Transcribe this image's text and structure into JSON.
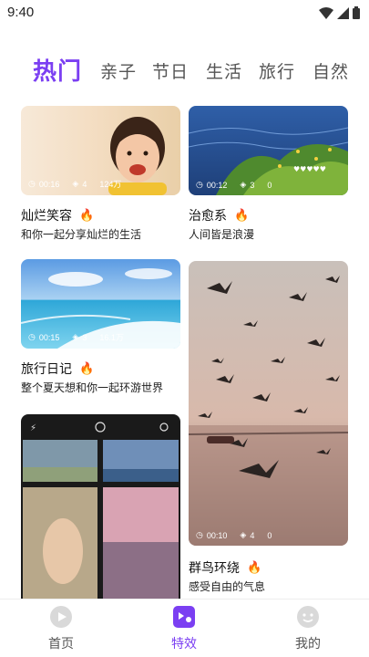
{
  "status": {
    "time": "9:40"
  },
  "tabs": [
    "热门",
    "亲子",
    "节日",
    "生活",
    "旅行",
    "自然"
  ],
  "cards": [
    {
      "title": "灿烂笑容",
      "subtitle": "和你一起分享灿烂的生活",
      "duration": "00:16",
      "layers": "4",
      "views": "124万"
    },
    {
      "title": "治愈系",
      "subtitle": "人间皆是浪漫",
      "duration": "00:12",
      "layers": "3",
      "views": "0"
    },
    {
      "title": "旅行日记",
      "subtitle": "整个夏天想和你一起环游世界",
      "duration": "00:15",
      "layers": "3",
      "views": "16.1万"
    },
    {
      "title": "群鸟环绕",
      "subtitle": "感受自由的气息",
      "duration": "00:10",
      "layers": "4",
      "views": "0"
    }
  ],
  "nav": {
    "home": "首页",
    "effects": "特效",
    "mine": "我的"
  },
  "colors": {
    "accent": "#7b3ff2"
  }
}
